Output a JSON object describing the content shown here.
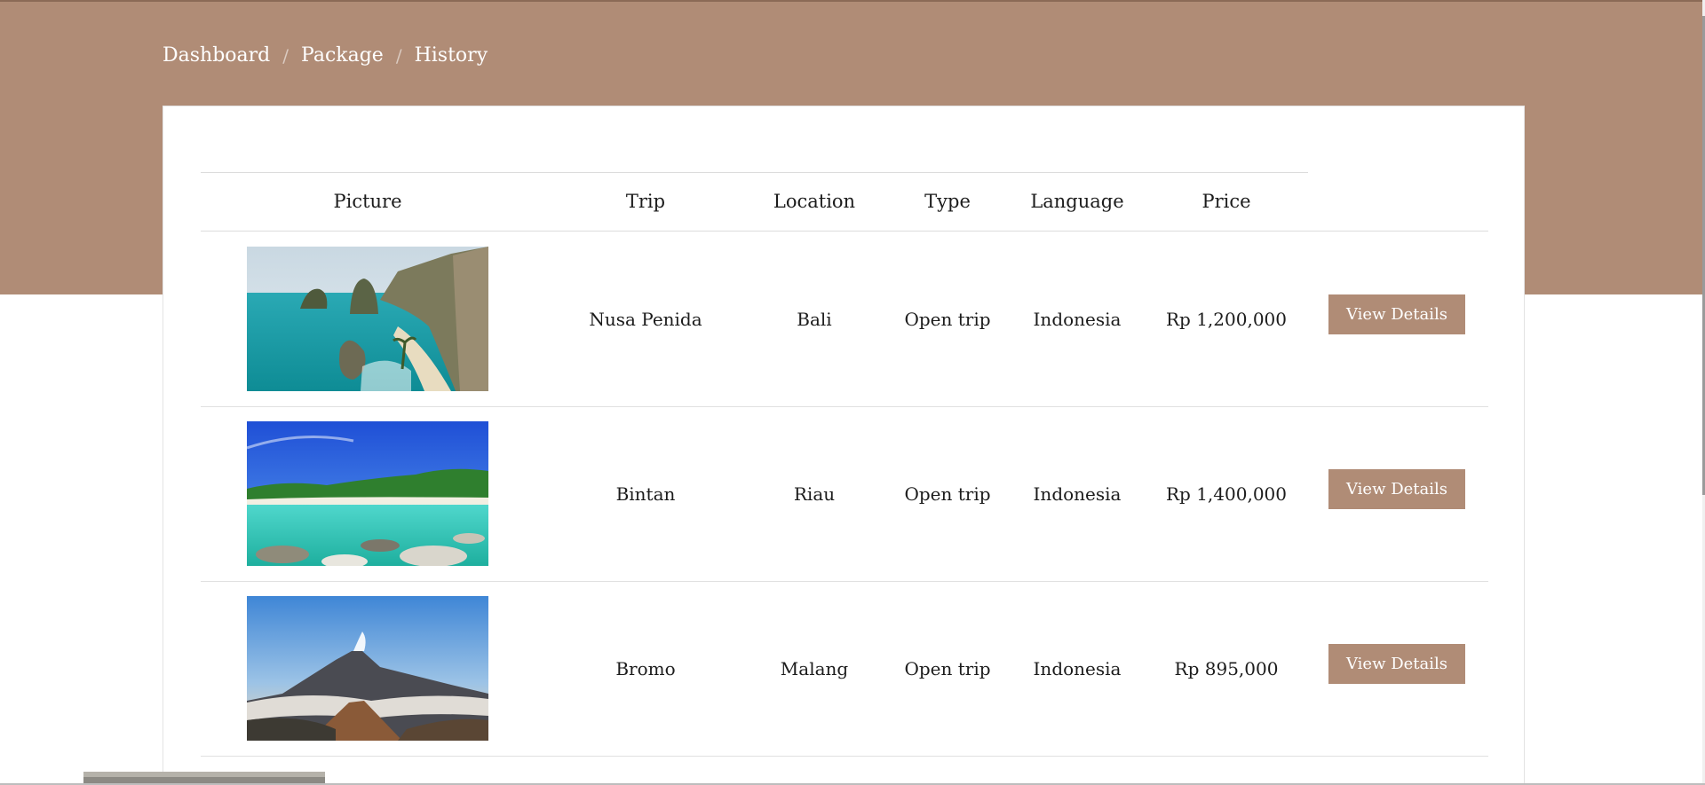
{
  "breadcrumb": {
    "items": [
      "Dashboard",
      "Package",
      "History"
    ],
    "separator": "/"
  },
  "table": {
    "columns": {
      "picture": "Picture",
      "trip": "Trip",
      "location": "Location",
      "type": "Type",
      "language": "Language",
      "price": "Price"
    },
    "rows": [
      {
        "trip": "Nusa Penida",
        "location": "Bali",
        "type": "Open trip",
        "language": "Indonesia",
        "price": "Rp 1,200,000",
        "action": "View Details",
        "picture_icon": "coastal-cliffs-photo"
      },
      {
        "trip": "Bintan",
        "location": "Riau",
        "type": "Open trip",
        "language": "Indonesia",
        "price": "Rp 1,400,000",
        "action": "View Details",
        "picture_icon": "tropical-beach-photo"
      },
      {
        "trip": "Bromo",
        "location": "Malang",
        "type": "Open trip",
        "language": "Indonesia",
        "price": "Rp 895,000",
        "action": "View Details",
        "picture_icon": "volcano-photo"
      }
    ]
  },
  "colors": {
    "accent": "#b08c76",
    "header_bg": "#b08c76",
    "button_text": "#ffffff"
  }
}
